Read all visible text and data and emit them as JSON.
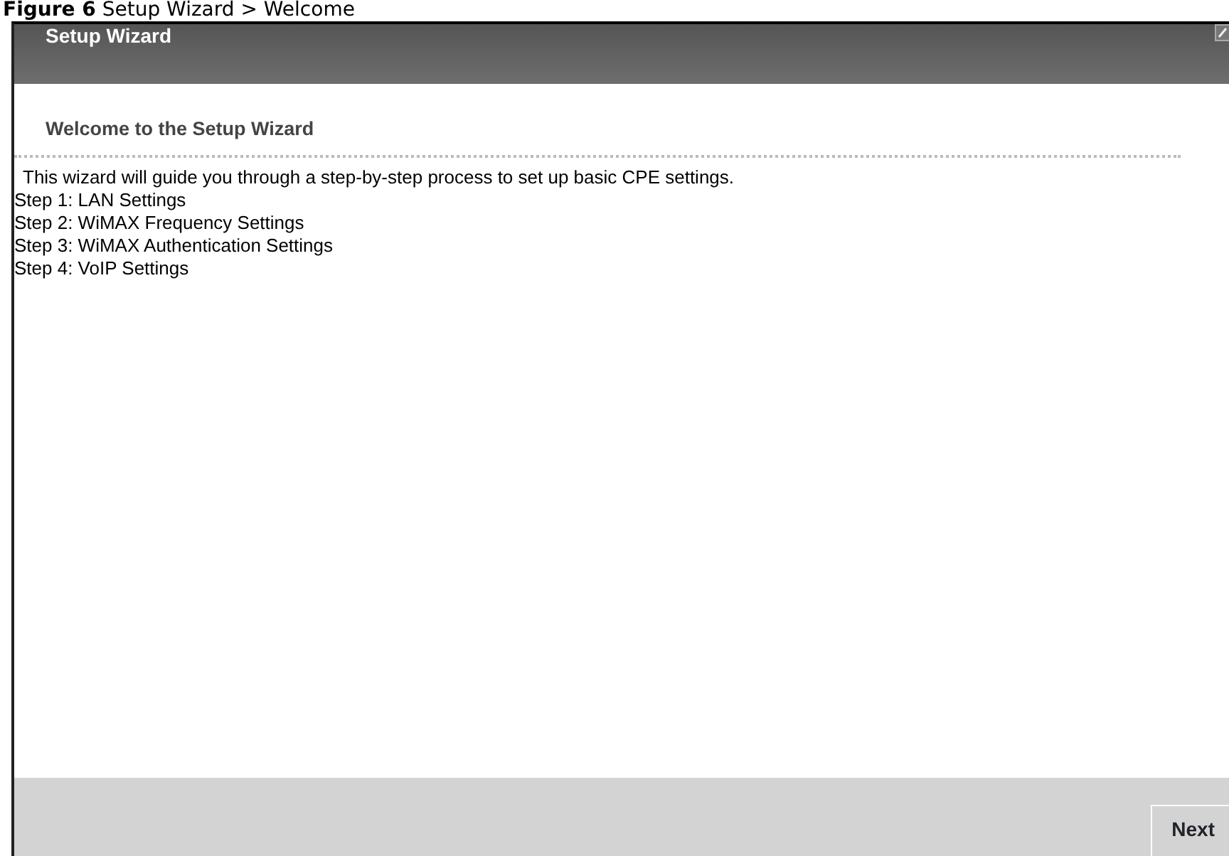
{
  "caption": {
    "label": "Figure 6",
    "text": "Setup Wizard > Welcome"
  },
  "window": {
    "title": "Setup Wizard"
  },
  "heading": "Welcome to the Setup Wizard",
  "intro": "This wizard will guide you through a step-by-step process to set up basic CPE settings.",
  "steps": [
    "Step 1: LAN Settings",
    "Step 2: WiMAX Frequency Settings",
    "Step 3: WiMAX Authentication Settings",
    "Step 4: VoIP Settings"
  ],
  "buttons": [
    "Next"
  ]
}
